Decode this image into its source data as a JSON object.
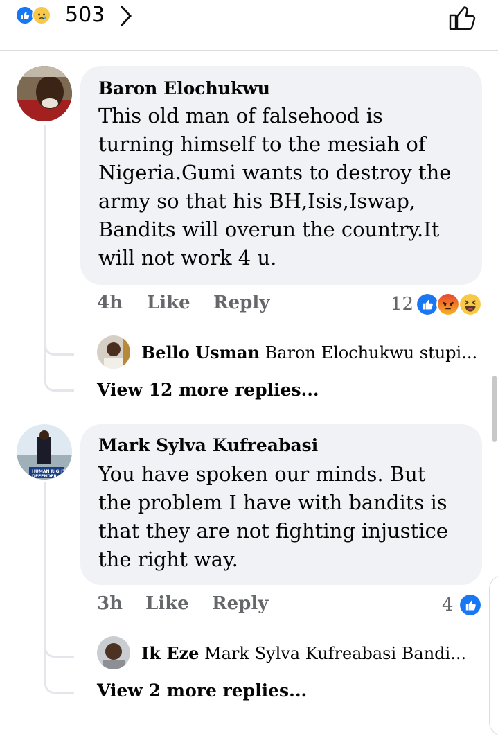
{
  "header": {
    "reaction_count": "503",
    "reactions": [
      "like-icon",
      "sad-icon"
    ]
  },
  "comments": [
    {
      "author": "Baron Elochukwu",
      "text": "This old man of falsehood is turning himself to the mesiah of Nigeria.Gumi wants to destroy the army so that his BH,Isis,Iswap, Bandits will overun the country.It will not work 4 u.",
      "lines": [
        "This old man of falsehood is",
        "turning himself to the mesiah of",
        "Nigeria.Gumi wants to destroy the",
        "army so that his BH,Isis,Iswap,",
        "Bandits will overun the country.It",
        "will not work 4 u."
      ],
      "time": "4h",
      "like_label": "Like",
      "reply_label": "Reply",
      "reaction_count": "12",
      "reaction_icons": [
        "like-icon",
        "angry-icon",
        "haha-icon"
      ],
      "reply_preview": {
        "author": "Bello Usman",
        "text": "Baron Elochukwu stupi..."
      },
      "view_more": "View 12 more replies..."
    },
    {
      "author": "Mark Sylva Kufreabasi",
      "text": "You have spoken our minds. But the problem I have with bandits is that they are not fighting injustice the right way.",
      "lines": [
        "You have spoken our minds. But",
        "the problem I have with bandits is",
        "that they are not fighting injustice",
        "the right way."
      ],
      "avatar_text": [
        "HUMAN RIGHTS",
        "DEFENDER"
      ],
      "time": "3h",
      "like_label": "Like",
      "reply_label": "Reply",
      "reaction_count": "4",
      "reaction_icons": [
        "like-icon"
      ],
      "reply_preview": {
        "author": "Ik Eze",
        "text": "Mark Sylva Kufreabasi Bandi..."
      },
      "view_more": "View 2 more replies..."
    }
  ],
  "colors": {
    "like_blue": "#1877f2",
    "bubble_gray": "#f0f2f5",
    "meta_gray": "#65676b"
  }
}
